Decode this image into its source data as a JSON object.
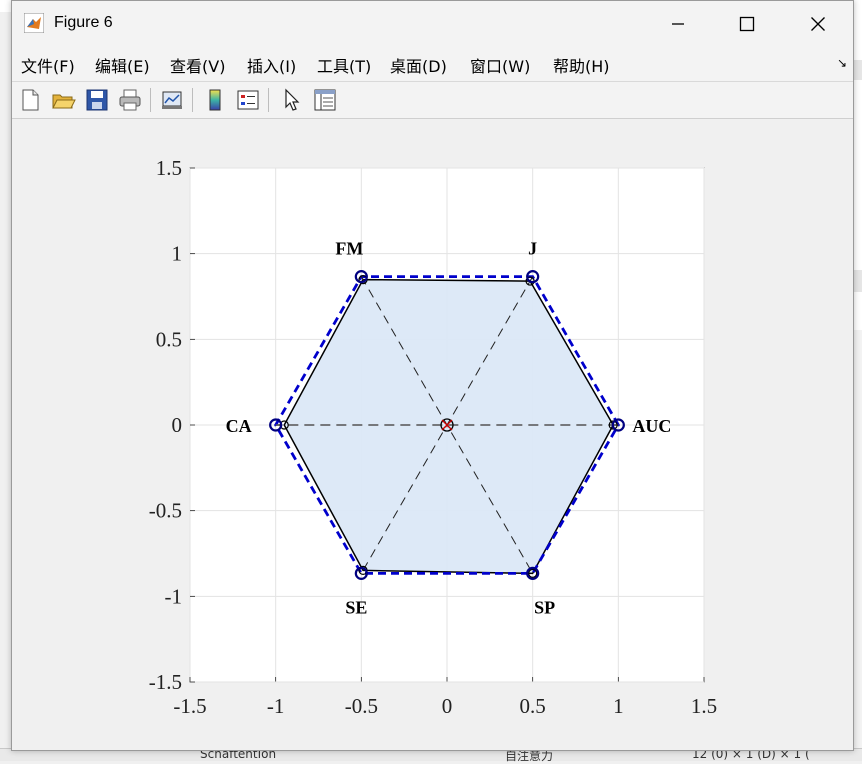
{
  "window": {
    "title": "Figure 6"
  },
  "menu": {
    "items": [
      "文件(F)",
      "编辑(E)",
      "查看(V)",
      "插入(I)",
      "工具(T)",
      "桌面(D)",
      "窗口(W)",
      "帮助(H)"
    ],
    "overflow_icon": "dock-arrow-icon"
  },
  "toolbar": {
    "icons": [
      "new-figure-icon",
      "open-file-icon",
      "save-icon",
      "print-icon",
      "link-plot-icon",
      "colorbar-icon",
      "legend-icon",
      "pointer-icon",
      "property-inspector-icon"
    ]
  },
  "background": {
    "bottom_text": "SchaftentIon",
    "bottom_text2": "自注意力",
    "bottom_text3": "12 (0)  ×  1 (D)  ×  1 ("
  },
  "colors": {
    "fill": "#dbe8f7",
    "solid": "#000000",
    "dashed": "#0000cc",
    "accent_marker": "#cc0000"
  },
  "chart_data": {
    "type": "radar",
    "xlim": [
      -1.5,
      1.5
    ],
    "ylim": [
      -1.5,
      1.5
    ],
    "xticks": [
      "-1.5",
      "-1",
      "-0.5",
      "0",
      "0.5",
      "1",
      "1.5"
    ],
    "yticks": [
      "1.5",
      "1",
      "0.5",
      "0",
      "-0.5",
      "-1",
      "-1.5"
    ],
    "grid": true,
    "axes_labels": [
      {
        "label": "AUC",
        "angle": 0
      },
      {
        "label": "J",
        "angle": 60
      },
      {
        "label": "FM",
        "angle": 120
      },
      {
        "label": "CA",
        "angle": 180
      },
      {
        "label": "SE",
        "angle": 240
      },
      {
        "label": "SP",
        "angle": 300
      }
    ],
    "series": [
      {
        "style": "solid-filled",
        "values": [
          0.97,
          0.97,
          0.98,
          0.95,
          0.98,
          1.0
        ]
      },
      {
        "style": "dashed",
        "values": [
          1.0,
          1.0,
          1.0,
          1.0,
          1.0,
          1.0
        ]
      }
    ]
  }
}
